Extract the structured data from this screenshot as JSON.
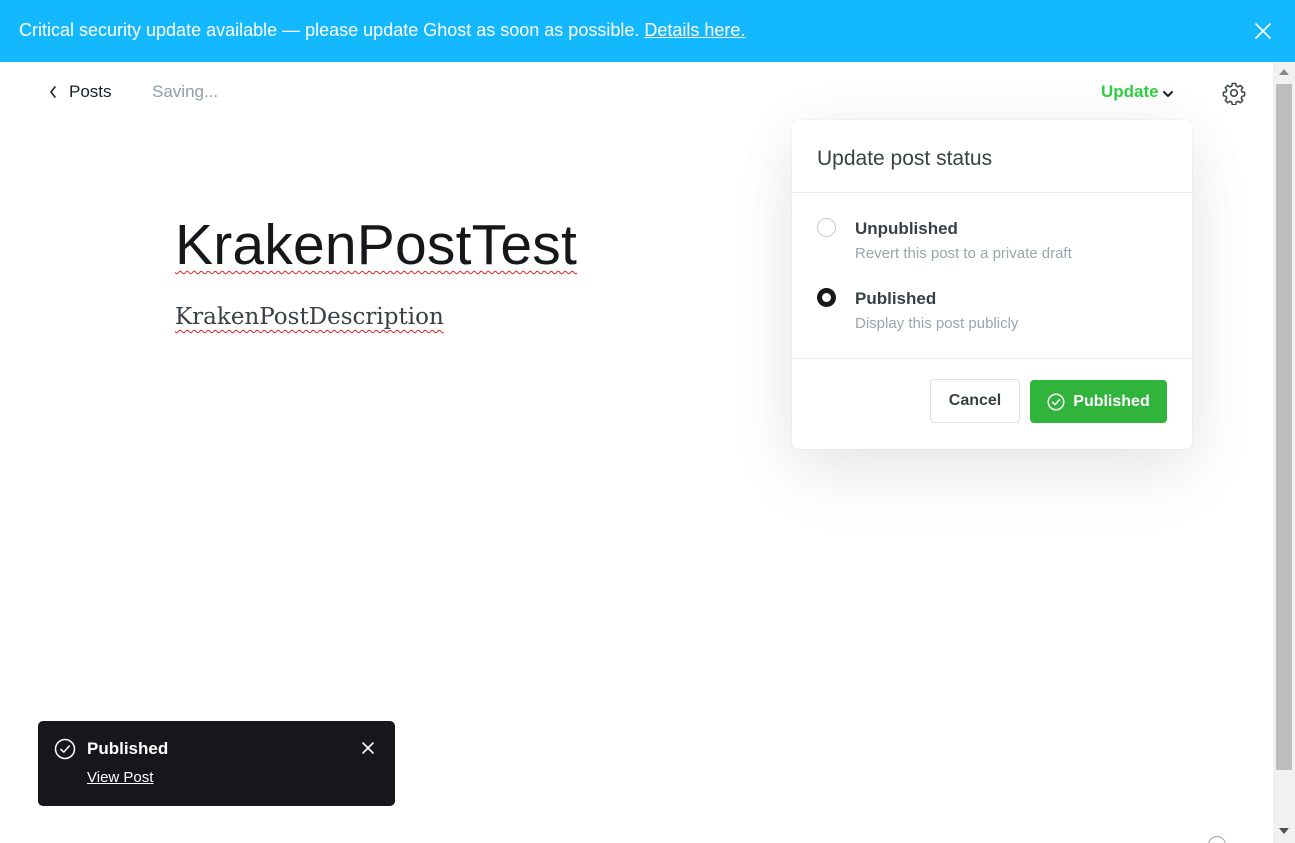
{
  "banner": {
    "message": "Critical security update available — please update Ghost as soon as possible.",
    "link_text": "Details here.",
    "close_icon": "close-icon"
  },
  "header": {
    "back_label": "Posts",
    "status_text": "Saving...",
    "update_label": "Update",
    "settings_icon": "gear-icon"
  },
  "editor": {
    "title": "KrakenPostTest",
    "excerpt": "KrakenPostDescription"
  },
  "popover": {
    "title": "Update post status",
    "options": [
      {
        "label": "Unpublished",
        "description": "Revert this post to a private draft",
        "selected": false
      },
      {
        "label": "Published",
        "description": "Display this post publicly",
        "selected": true
      }
    ],
    "cancel_label": "Cancel",
    "confirm_label": "Published"
  },
  "toast": {
    "title": "Published",
    "link_text": "View Post"
  },
  "colors": {
    "banner_bg": "#14b8ff",
    "accent_green": "#30cf43",
    "button_green": "#30b43c",
    "toast_bg": "#15171a"
  }
}
